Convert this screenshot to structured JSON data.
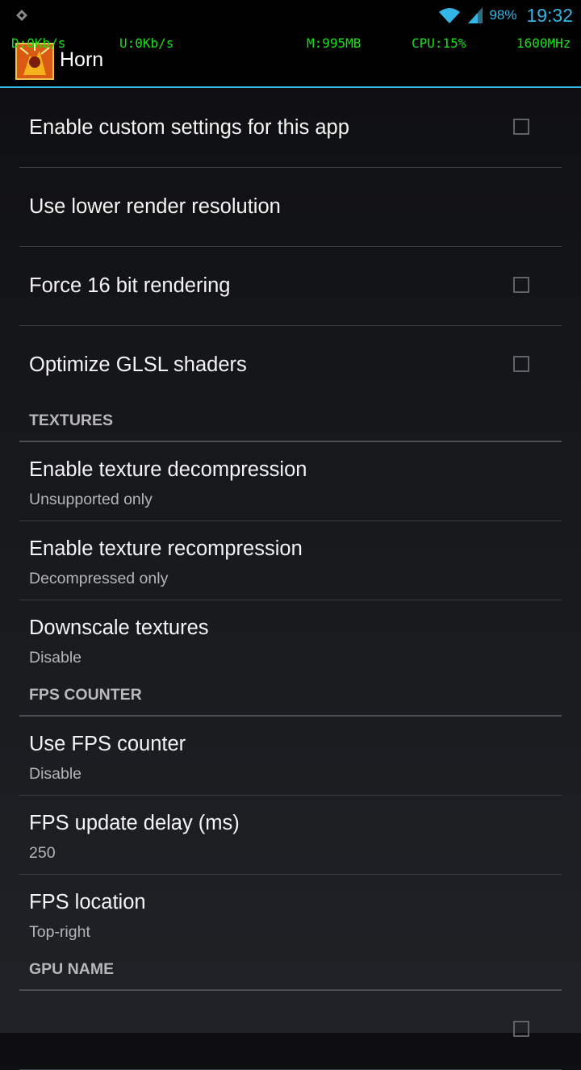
{
  "status_bar": {
    "battery": "98%",
    "time": "19:32"
  },
  "overlay": {
    "download": "D:0Kb/s",
    "upload": "U:0Kb/s",
    "memory": "M:995MB",
    "cpu": "CPU:15%",
    "freq": "1600MHz"
  },
  "action_bar": {
    "title": "Horn"
  },
  "settings": {
    "custom": {
      "title": "Enable custom settings for this app",
      "checked": false
    },
    "lower_res": {
      "title": "Use lower render resolution"
    },
    "force16": {
      "title": "Force 16 bit rendering",
      "checked": false
    },
    "glsl": {
      "title": "Optimize GLSL shaders",
      "checked": false
    },
    "textures_header": "TEXTURES",
    "decompress": {
      "title": "Enable texture decompression",
      "summary": "Unsupported only"
    },
    "recompress": {
      "title": "Enable texture recompression",
      "summary": "Decompressed only"
    },
    "downscale": {
      "title": "Downscale textures",
      "summary": "Disable"
    },
    "fps_header": "FPS COUNTER",
    "fps_counter": {
      "title": "Use FPS counter",
      "summary": "Disable"
    },
    "fps_delay": {
      "title": "FPS update delay (ms)",
      "summary": "250"
    },
    "fps_location": {
      "title": "FPS location",
      "summary": "Top-right"
    },
    "gpu_header": "GPU NAME"
  },
  "colors": {
    "accent": "#33b5e5",
    "overlay_text": "#18e018"
  }
}
